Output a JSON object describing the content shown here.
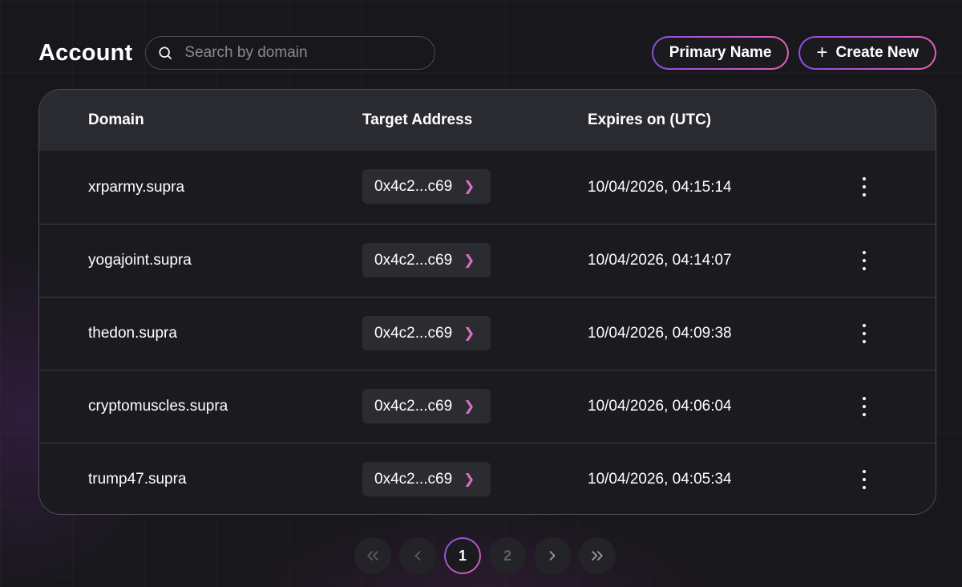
{
  "header": {
    "title": "Account",
    "search_placeholder": "Search by domain",
    "primary_name_label": "Primary Name",
    "create_new_label": "Create New",
    "create_new_icon": "+"
  },
  "table": {
    "columns": [
      "Domain",
      "Target Address",
      "Expires on (UTC)"
    ],
    "rows": [
      {
        "domain": "xrparmy.supra",
        "address": "0x4c2...c69",
        "expires": "10/04/2026, 04:15:14"
      },
      {
        "domain": "yogajoint.supra",
        "address": "0x4c2...c69",
        "expires": "10/04/2026, 04:14:07"
      },
      {
        "domain": "thedon.supra",
        "address": "0x4c2...c69",
        "expires": "10/04/2026, 04:09:38"
      },
      {
        "domain": "cryptomuscles.supra",
        "address": "0x4c2...c69",
        "expires": "10/04/2026, 04:06:04"
      },
      {
        "domain": "trump47.supra",
        "address": "0x4c2...c69",
        "expires": "10/04/2026, 04:05:34"
      }
    ]
  },
  "pagination": {
    "pages": [
      "1",
      "2"
    ],
    "current": "1"
  },
  "colors": {
    "accent_start": "#8b4fe0",
    "accent_end": "#e35fb5",
    "background": "#18171b",
    "header_row": "#2a2b31"
  }
}
